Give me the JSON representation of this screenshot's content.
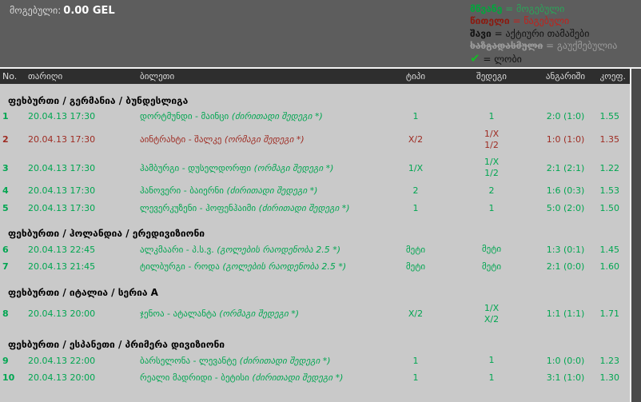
{
  "header_bar": {
    "won_label": "მოგებული:",
    "won_amount": "0.00 GEL",
    "legend": [
      {
        "type": "green",
        "term": "მწვანე",
        "eq": " = ",
        "desc": "მოგებული"
      },
      {
        "type": "red",
        "term": "წითელი",
        "eq": " = ",
        "desc": "წაგებული"
      },
      {
        "type": "black",
        "term": "შავი",
        "eq": " = ",
        "desc": "აქტიური თამაშები"
      },
      {
        "type": "gray",
        "term": "ხაზგადასმული",
        "eq": " = ",
        "desc": "გაუქმებულია"
      },
      {
        "type": "check",
        "term": "✔",
        "eq": " = ",
        "desc": "ლობი"
      }
    ]
  },
  "table": {
    "columns": {
      "no": "No.",
      "date": "თარიღი",
      "ticket": "ბილეთი",
      "type": "ტიპი",
      "result": "შედეგი",
      "score": "ანგარიში",
      "coef": "კოეფ."
    },
    "sections": [
      {
        "title": "ფეხბურთი / გერმანია / ბუნდესლიგა",
        "rows": [
          {
            "no": "1",
            "date": "20.04.13 17:30",
            "match": "დორტმუნდი - მაინცი ",
            "bet": "(ძირითადი შედეგი *)",
            "type": "1",
            "result": [
              "1"
            ],
            "score": "2:0 (1:0)",
            "coef": "1.55",
            "status": "won"
          },
          {
            "no": "2",
            "date": "20.04.13 17:30",
            "match": "აინტრახტი - შალკე ",
            "bet": "(ორმაგი შედეგი *)",
            "type": "X/2",
            "result": [
              "1/X",
              "1/2"
            ],
            "score": "1:0 (1:0)",
            "coef": "1.35",
            "status": "lost"
          },
          {
            "no": "3",
            "date": "20.04.13 17:30",
            "match": "ჰამბურგი - დუსელდორფი ",
            "bet": "(ორმაგი შედეგი *)",
            "type": "1/X",
            "result": [
              "1/X",
              "1/2"
            ],
            "score": "2:1 (2:1)",
            "coef": "1.22",
            "status": "won"
          },
          {
            "no": "4",
            "date": "20.04.13 17:30",
            "match": "ჰანოვერი - ბაიერნი ",
            "bet": "(ძირითადი შედეგი *)",
            "type": "2",
            "result": [
              "2"
            ],
            "score": "1:6 (0:3)",
            "coef": "1.53",
            "status": "won"
          },
          {
            "no": "5",
            "date": "20.04.13 17:30",
            "match": "ლევერკუზენი - ჰოფენჰაიმი ",
            "bet": "(ძირითადი შედეგი *)",
            "type": "1",
            "result": [
              "1"
            ],
            "score": "5:0 (2:0)",
            "coef": "1.50",
            "status": "won"
          }
        ]
      },
      {
        "title": "ფეხბურთი / ჰოლანდია / ერედივიზიონი",
        "rows": [
          {
            "no": "6",
            "date": "20.04.13 22:45",
            "match": "ალკმაარი - პ.ს.ვ. ",
            "bet": "(გოლების რაოდენობა 2.5 *)",
            "type": "მეტი",
            "result": [
              "მეტი"
            ],
            "score": "1:3 (0:1)",
            "coef": "1.45",
            "status": "won"
          },
          {
            "no": "7",
            "date": "20.04.13 21:45",
            "match": "ტილბურგი - როდა ",
            "bet": "(გოლების რაოდენობა 2.5 *)",
            "type": "მეტი",
            "result": [
              "მეტი"
            ],
            "score": "2:1 (0:0)",
            "coef": "1.60",
            "status": "won"
          }
        ]
      },
      {
        "title": "ფეხბურთი / იტალია / სერია A",
        "rows": [
          {
            "no": "8",
            "date": "20.04.13 20:00",
            "match": "ჯენოა - ატალანტა ",
            "bet": "(ორმაგი შედეგი *)",
            "type": "X/2",
            "result": [
              "1/X",
              "X/2"
            ],
            "score": "1:1 (1:1)",
            "coef": "1.71",
            "status": "won"
          }
        ]
      },
      {
        "title": "ფეხბურთი / ესპანეთი / პრიმერა დივიზიონი",
        "rows": [
          {
            "no": "9",
            "date": "20.04.13 22:00",
            "match": "ბარსელონა - ლევანტე ",
            "bet": "(ძირითადი შედეგი *)",
            "type": "1",
            "result": [
              "1"
            ],
            "score": "1:0 (0:0)",
            "coef": "1.23",
            "status": "won"
          },
          {
            "no": "10",
            "date": "20.04.13 20:00",
            "match": "რეალი მადრიდი - ბეტისი ",
            "bet": "(ძირითადი შედეგი *)",
            "type": "1",
            "result": [
              "1"
            ],
            "score": "3:1 (1:0)",
            "coef": "1.30",
            "status": "won"
          }
        ]
      }
    ]
  },
  "colors": {
    "won_green": "#00a651",
    "lost_red": "#9e2b22",
    "header_bg": "#2e2e2e",
    "body_bg": "#c9c9c9",
    "page_bg": "#5d5d5d",
    "check_green": "#17b928"
  }
}
